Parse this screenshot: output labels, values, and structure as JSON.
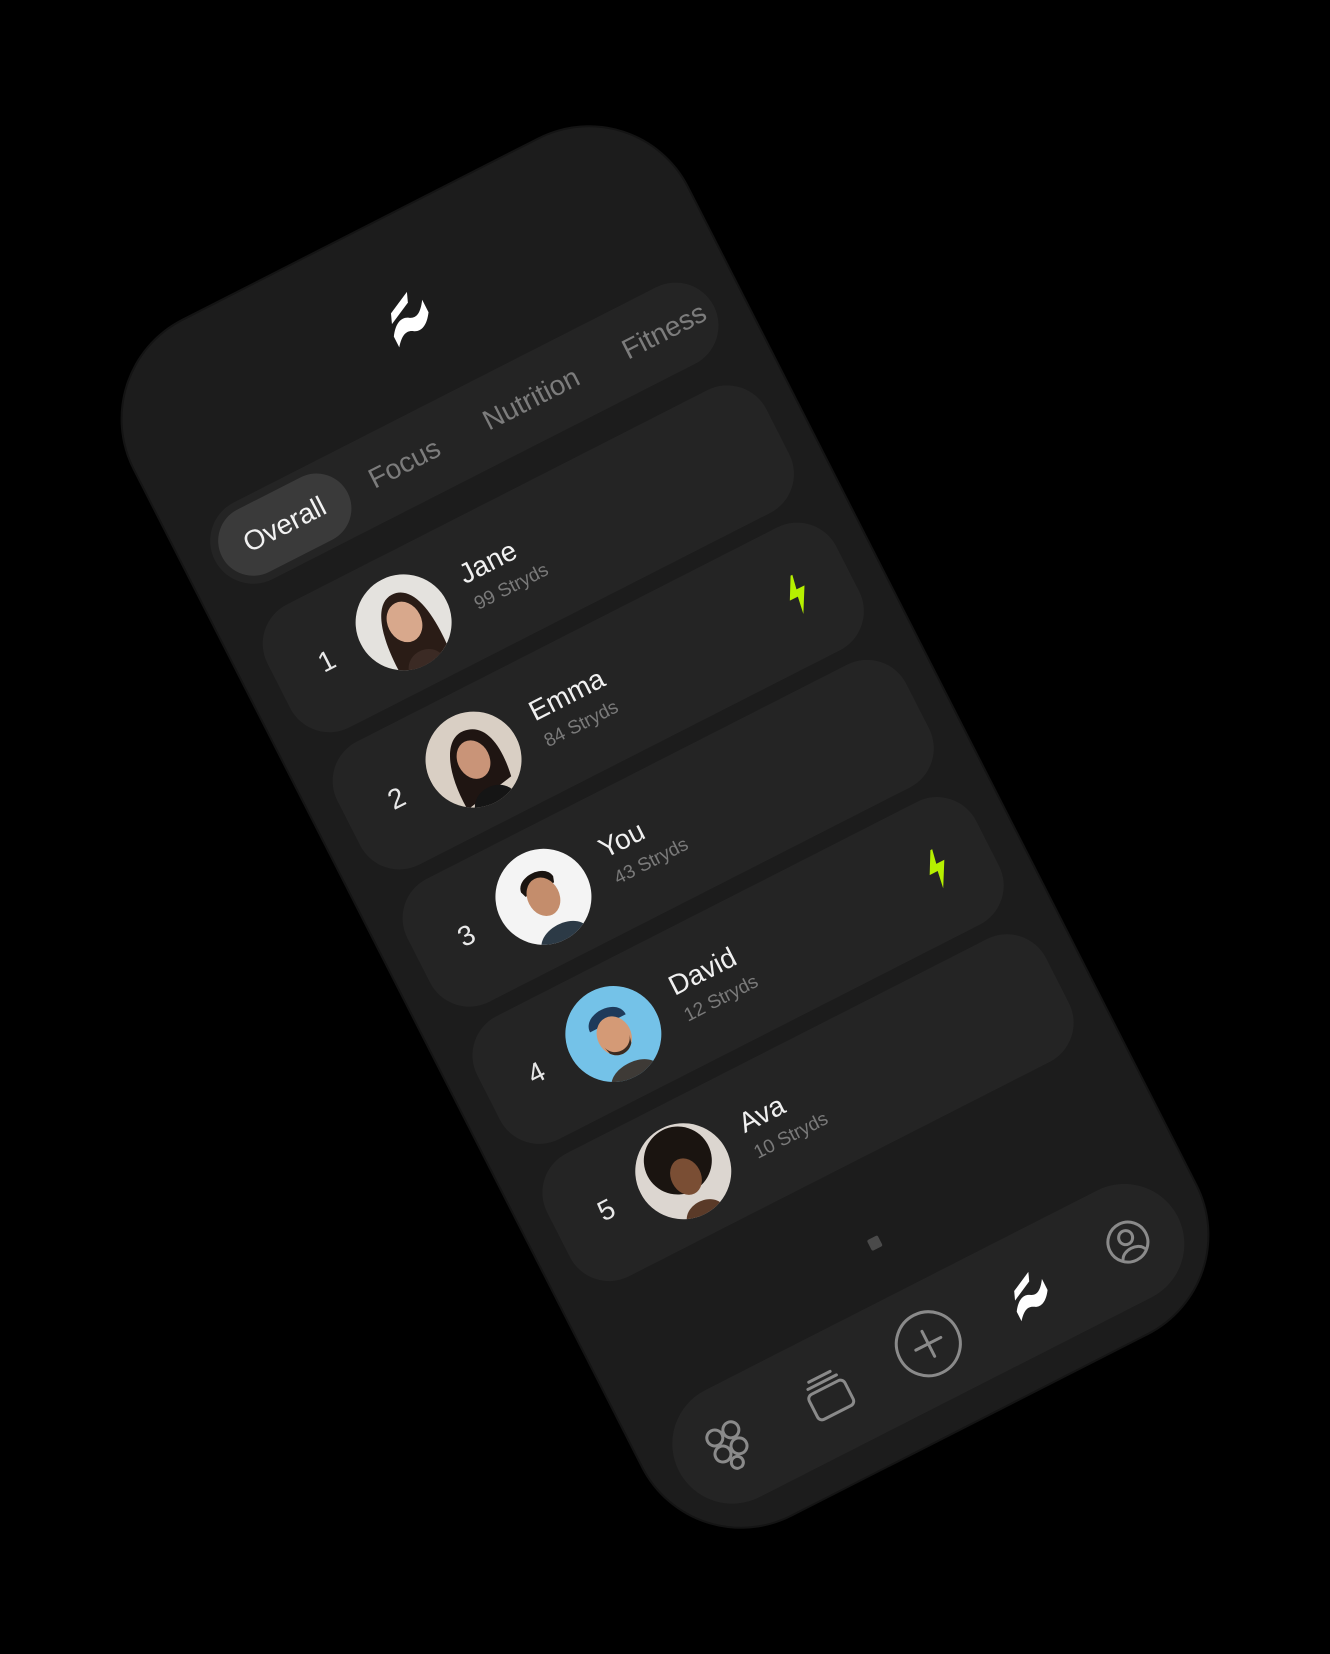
{
  "app": {
    "logo_icon": "stryd-logo-icon"
  },
  "tabs": [
    {
      "label": "Overall",
      "active": true
    },
    {
      "label": "Focus",
      "active": false
    },
    {
      "label": "Nutrition",
      "active": false
    },
    {
      "label": "Fitness",
      "active": false
    }
  ],
  "leaderboard": [
    {
      "rank": "1",
      "name": "Jane",
      "score": "99 Stryds",
      "boosted": false
    },
    {
      "rank": "2",
      "name": "Emma",
      "score": "84 Stryds",
      "boosted": true
    },
    {
      "rank": "3",
      "name": "You",
      "score": "43 Stryds",
      "boosted": false
    },
    {
      "rank": "4",
      "name": "David",
      "score": "12 Stryds",
      "boosted": true
    },
    {
      "rank": "5",
      "name": "Ava",
      "score": "10 Stryds",
      "boosted": false
    }
  ],
  "nav": [
    {
      "icon": "circles-grid-icon",
      "active": false
    },
    {
      "icon": "stacked-cards-icon",
      "active": false
    },
    {
      "icon": "plus-circle-icon",
      "active": false
    },
    {
      "icon": "stryd-logo-icon",
      "active": true
    },
    {
      "icon": "profile-icon",
      "active": false
    }
  ],
  "colors": {
    "background": "#000000",
    "phone": "#1c1c1c",
    "card": "#242424",
    "tab_active": "#3a3a3a",
    "accent_bolt": "#b6f000",
    "text_primary": "#f0f0f0",
    "text_secondary": "#7a7a7a"
  }
}
